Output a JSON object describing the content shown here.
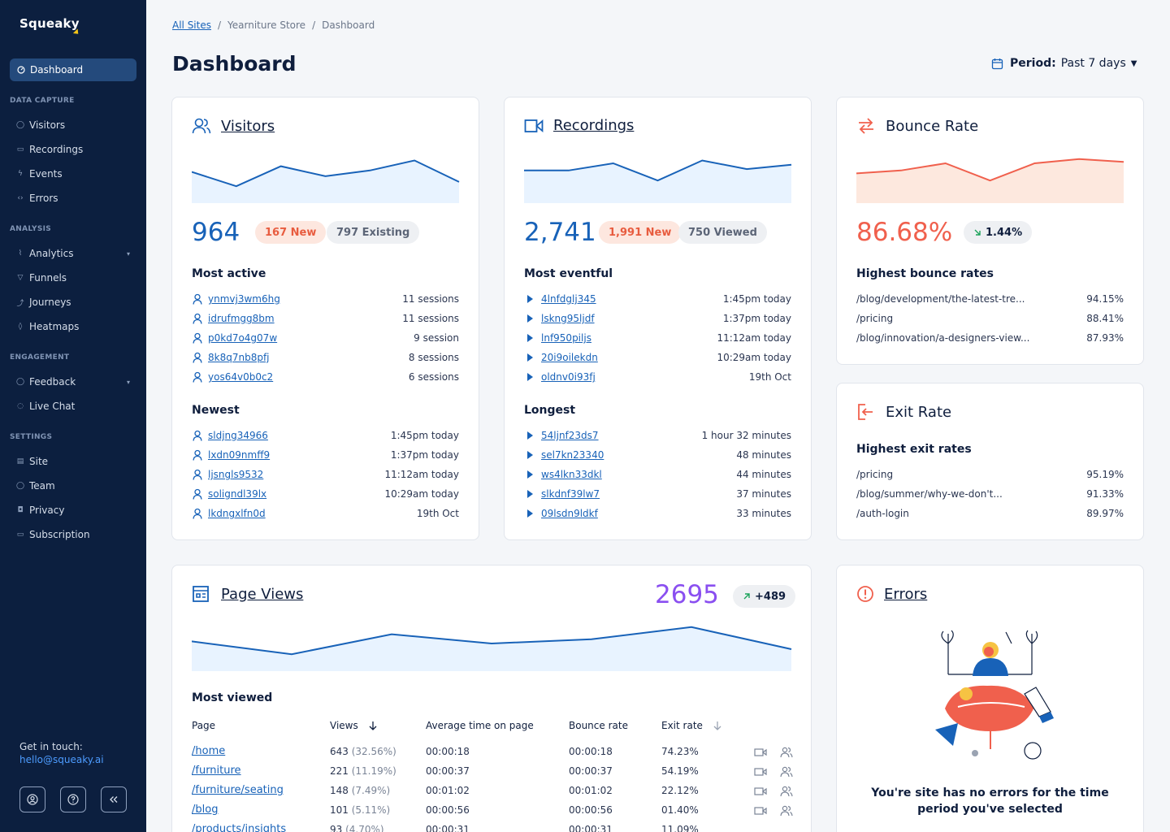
{
  "app": {
    "name": "Squeaky"
  },
  "sidebar": {
    "active": "Dashboard",
    "sections": [
      {
        "title": "DATA CAPTURE",
        "items": [
          "Visitors",
          "Recordings",
          "Events",
          "Errors"
        ]
      },
      {
        "title": "ANALYSIS",
        "items": [
          "Analytics",
          "Funnels",
          "Journeys",
          "Heatmaps"
        ]
      },
      {
        "title": "ENGAGEMENT",
        "items": [
          "Feedback",
          "Live Chat"
        ]
      },
      {
        "title": "SETTINGS",
        "items": [
          "Site",
          "Team",
          "Privacy",
          "Subscription"
        ]
      }
    ],
    "get_in_touch": "Get in touch:",
    "email": "hello@squeaky.ai"
  },
  "breadcrumb": [
    "All Sites",
    "Yearniture Store",
    "Dashboard"
  ],
  "page_title": "Dashboard",
  "period": {
    "label": "Period:",
    "value": "Past 7 days"
  },
  "visitors": {
    "title": "Visitors",
    "total": "964",
    "new": "167 New",
    "existing": "797 Existing",
    "trend": [
      30,
      10,
      38,
      24,
      32,
      46,
      16
    ],
    "most_active_title": "Most active",
    "most_active": [
      {
        "id": "ynmvj3wm6hg",
        "value": "11 sessions"
      },
      {
        "id": "idrufmgg8bm",
        "value": "11 sessions"
      },
      {
        "id": "p0kd7o4g07w",
        "value": "9 session"
      },
      {
        "id": "8k8q7nb8pfj",
        "value": "8 sessions"
      },
      {
        "id": "yos64v0b0c2",
        "value": "6 sessions"
      }
    ],
    "newest_title": "Newest",
    "newest": [
      {
        "id": "sldjng34966",
        "value": "1:45pm today"
      },
      {
        "id": "lxdn09nmff9",
        "value": "1:37pm today"
      },
      {
        "id": "ljsngls9532",
        "value": "11:12am today"
      },
      {
        "id": "soligndl39lx",
        "value": "10:29am today"
      },
      {
        "id": "lkdngxlfn0d",
        "value": "19th Oct"
      }
    ]
  },
  "recordings": {
    "title": "Recordings",
    "total": "2,741",
    "new": "1,991 New",
    "viewed": "750 Viewed",
    "trend": [
      32,
      32,
      42,
      18,
      46,
      34,
      40
    ],
    "eventful_title": "Most eventful",
    "eventful": [
      {
        "id": "4lnfdglj345",
        "value": "1:45pm today"
      },
      {
        "id": "lskng95ljdf",
        "value": "1:37pm today"
      },
      {
        "id": "lnf950piljs",
        "value": "11:12am today"
      },
      {
        "id": "20i9oilekdn",
        "value": "10:29am today"
      },
      {
        "id": "oldnv0i93fj",
        "value": "19th Oct"
      }
    ],
    "longest_title": "Longest",
    "longest": [
      {
        "id": "54ljnf23ds7",
        "value": "1 hour 32 minutes"
      },
      {
        "id": "sel7kn23340",
        "value": "48 minutes"
      },
      {
        "id": "ws4lkn33dkl",
        "value": "44 minutes"
      },
      {
        "id": "slkdnf39lw7",
        "value": "37 minutes"
      },
      {
        "id": "09lsdn9ldkf",
        "value": "33 minutes"
      }
    ]
  },
  "bounce": {
    "title": "Bounce Rate",
    "value": "86.68%",
    "change": "1.44%",
    "trend": [
      28,
      32,
      42,
      18,
      42,
      48,
      44
    ],
    "list_title": "Highest bounce rates",
    "pages": [
      {
        "path": "/blog/development/the-latest-tre...",
        "value": "94.15%"
      },
      {
        "path": "/pricing",
        "value": "88.41%"
      },
      {
        "path": "/blog/innovation/a-designers-view...",
        "value": "87.93%"
      }
    ]
  },
  "exit": {
    "title": "Exit Rate",
    "list_title": "Highest exit rates",
    "pages": [
      {
        "path": "/pricing",
        "value": "95.19%"
      },
      {
        "path": "/blog/summer/why-we-don't...",
        "value": "91.33%"
      },
      {
        "path": "/auth-login",
        "value": "89.97%"
      }
    ]
  },
  "page_views": {
    "title": "Page Views",
    "total": "2695",
    "change": "+489",
    "trend": [
      28,
      10,
      38,
      25,
      31,
      48,
      17
    ],
    "most_viewed_title": "Most viewed",
    "columns": [
      "Page",
      "Views",
      "Average time on page",
      "Bounce rate",
      "Exit rate"
    ],
    "rows": [
      {
        "page": "/home",
        "views": "643",
        "pct": "(32.56%)",
        "avg": "00:00:18",
        "bounce": "00:00:18",
        "exit": "74.23%"
      },
      {
        "page": "/furniture",
        "views": "221",
        "pct": "(11.19%)",
        "avg": "00:00:37",
        "bounce": "00:00:37",
        "exit": "54.19%"
      },
      {
        "page": "/furniture/seating",
        "views": "148",
        "pct": "(7.49%)",
        "avg": "00:01:02",
        "bounce": "00:01:02",
        "exit": "22.12%"
      },
      {
        "page": "/blog",
        "views": "101",
        "pct": "(5.11%)",
        "avg": "00:00:56",
        "bounce": "00:00:56",
        "exit": "01.40%"
      },
      {
        "page": "/products/insights",
        "views": "93",
        "pct": "(4.70%)",
        "avg": "00:00:31",
        "bounce": "00:00:31",
        "exit": "11.09%"
      }
    ]
  },
  "errors": {
    "title": "Errors",
    "message_line1": "You're site has no errors for the time",
    "message_line2": "period you've selected"
  },
  "colors": {
    "sidebar": "#0c1f3f",
    "primary": "#1862b8",
    "coral": "#f0604d",
    "purple": "#8a4ff0"
  }
}
